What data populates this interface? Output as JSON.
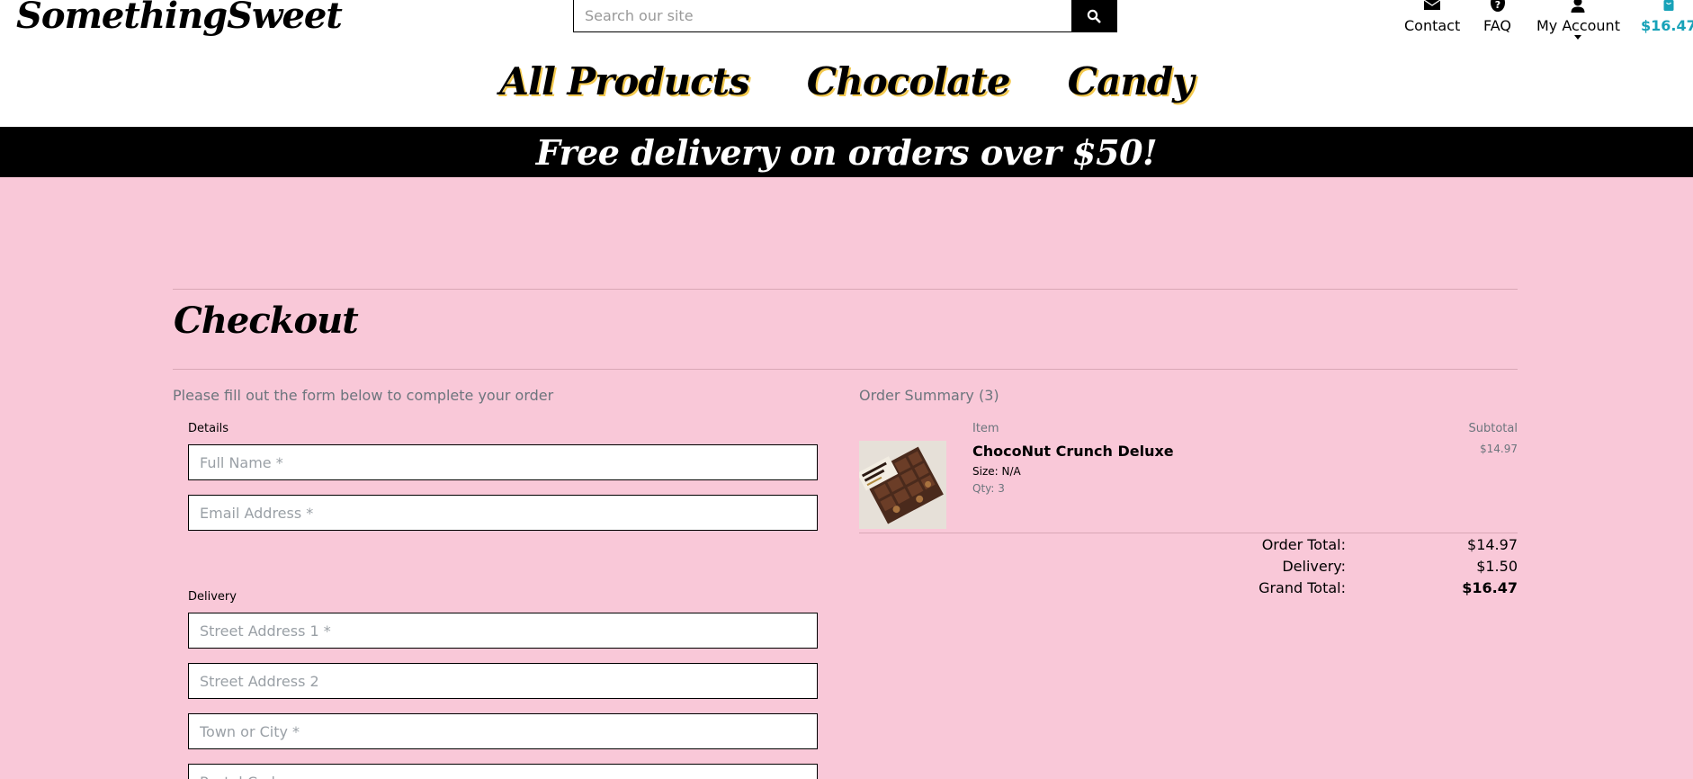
{
  "header": {
    "logo": "SomethingSweet",
    "search_placeholder": "Search our site",
    "utility": {
      "contact": "Contact",
      "faq": "FAQ",
      "account": "My Account",
      "cart_total": "$16.47"
    },
    "icons": [
      "search-icon",
      "envelope-icon",
      "question-circle-icon",
      "user-icon",
      "shopping-bag-icon",
      "caret-down-icon"
    ]
  },
  "nav": [
    "All Products",
    "Chocolate",
    "Candy"
  ],
  "banner": "Free delivery on orders over $50!",
  "page": {
    "title": "Checkout",
    "intro": "Please fill out the form below to complete your order"
  },
  "form": {
    "details_label": "Details",
    "full_name_placeholder": "Full Name *",
    "email_placeholder": "Email Address *",
    "delivery_label": "Delivery",
    "street1_placeholder": "Street Address 1 *",
    "street2_placeholder": "Street Address 2",
    "town_placeholder": "Town or City *",
    "postcode_placeholder": "Postal Code"
  },
  "summary": {
    "heading": "Order Summary (3)",
    "item_col": "Item",
    "subtotal_col": "Subtotal",
    "items": [
      {
        "name": "ChocoNut Crunch Deluxe",
        "size": "Size: N/A",
        "qty": "Qty: 3",
        "subtotal": "$14.97"
      }
    ],
    "totals": {
      "order_total_label": "Order Total:",
      "order_total": "$14.97",
      "delivery_label": "Delivery:",
      "delivery": "$1.50",
      "grand_total_label": "Grand Total:",
      "grand_total": "$16.47"
    }
  },
  "colors": {
    "background": "#f9c8d8",
    "accent": "#17a2b8",
    "banner": "#000000",
    "nav_shadow": "#f3c94e"
  }
}
